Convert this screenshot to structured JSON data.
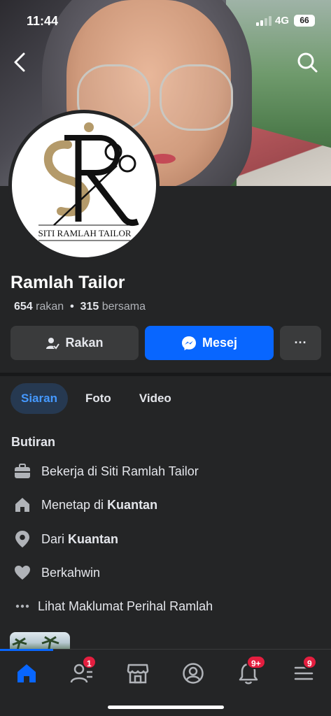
{
  "status_bar": {
    "time": "11:44",
    "network": "4G",
    "battery": "66"
  },
  "profile": {
    "name": "Ramlah Tailor",
    "friends_count": "654",
    "friends_label": "rakan",
    "separator": "•",
    "mutual_count": "315",
    "mutual_label": "bersama",
    "logo_text": "SITI RAMLAH TAILOR"
  },
  "actions": {
    "friends_label": "Rakan",
    "message_label": "Mesej",
    "more_label": "···"
  },
  "tabs": [
    {
      "label": "Siaran",
      "active": true
    },
    {
      "label": "Foto",
      "active": false
    },
    {
      "label": "Video",
      "active": false
    }
  ],
  "details": {
    "title": "Butiran",
    "work": {
      "prefix": "Bekerja di Siti Ramlah Tailor",
      "icon": "briefcase-icon"
    },
    "lives": {
      "prefix": "Menetap di",
      "value": "Kuantan",
      "icon": "home-icon"
    },
    "from": {
      "prefix": "Dari",
      "value": "Kuantan",
      "icon": "location-pin-icon"
    },
    "relationship": {
      "prefix": "Berkahwin",
      "icon": "heart-icon"
    },
    "about": {
      "prefix": "Lihat Maklumat Perihal Ramlah",
      "icon": "more-dots-icon"
    }
  },
  "nav": {
    "friends_badge": "1",
    "notifications_badge": "9+",
    "menu_badge": "9"
  },
  "colors": {
    "accent": "#0866ff",
    "background": "#242526",
    "badge": "#e41e3f",
    "tab_active_text": "#4599ff"
  }
}
